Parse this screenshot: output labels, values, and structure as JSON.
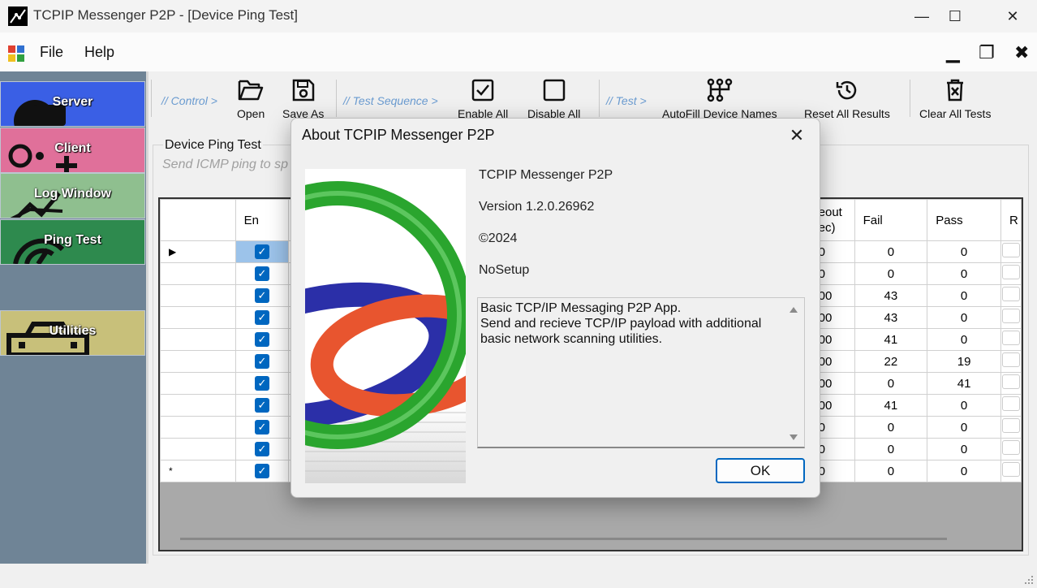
{
  "window": {
    "title": "TCPIP Messenger P2P - [Device Ping Test]",
    "minimize_glyph": "—",
    "maximize_glyph": "☐",
    "close_glyph": "✕"
  },
  "menu": {
    "items": [
      "File",
      "Help"
    ],
    "mdi_minimize": "▁",
    "mdi_restore": "❐",
    "mdi_close": "✖"
  },
  "sidebar": {
    "items": [
      {
        "label": "Server",
        "color": "#3a5fe5",
        "icon": "server-icon"
      },
      {
        "label": "Client",
        "color": "#e0709a",
        "icon": "client-icon"
      },
      {
        "label": "Log Window",
        "color": "#8fbf8f",
        "icon": "chart-icon"
      },
      {
        "label": "Ping Test",
        "color": "#2e8a4e",
        "icon": "ping-icon"
      },
      {
        "label": "Utilities",
        "color": "#c8c07a",
        "icon": "toolbox-icon"
      }
    ]
  },
  "toolbar": {
    "control_label": "// Control >",
    "test_sequence_label": "// Test Sequence >",
    "test_label": "// Test >",
    "buttons": {
      "open": "Open",
      "save_as": "Save As",
      "enable_all": "Enable All",
      "disable_all": "Disable All",
      "autofill": "AutoFill Device Names",
      "reset_all": "Reset All Results",
      "clear_all": "Clear All Tests"
    }
  },
  "group": {
    "title": "Device Ping Test",
    "subtitle": "Send ICMP ping to sp"
  },
  "grid": {
    "columns": {
      "enabled": "En",
      "timeout": "eout\nec)",
      "fail": "Fail",
      "pass": "Pass",
      "result": "R"
    },
    "rows": [
      {
        "marker": "▶",
        "timeout": "0",
        "fail": "0",
        "pass": "0"
      },
      {
        "marker": "",
        "timeout": "0",
        "fail": "0",
        "pass": "0"
      },
      {
        "marker": "",
        "timeout": "00",
        "fail": "43",
        "pass": "0"
      },
      {
        "marker": "",
        "timeout": "00",
        "fail": "43",
        "pass": "0"
      },
      {
        "marker": "",
        "timeout": "00",
        "fail": "41",
        "pass": "0"
      },
      {
        "marker": "",
        "timeout": "00",
        "fail": "22",
        "pass": "19"
      },
      {
        "marker": "",
        "timeout": "00",
        "fail": "0",
        "pass": "41"
      },
      {
        "marker": "",
        "timeout": "00",
        "fail": "41",
        "pass": "0"
      },
      {
        "marker": "",
        "timeout": "0",
        "fail": "0",
        "pass": "0"
      },
      {
        "marker": "",
        "timeout": "0",
        "fail": "0",
        "pass": "0"
      },
      {
        "marker": "*",
        "timeout": "0",
        "fail": "0",
        "pass": "0"
      }
    ],
    "checkbox_glyph": "✓"
  },
  "about_dialog": {
    "title": "About TCPIP Messenger P2P",
    "close_glyph": "✕",
    "product": "TCPIP Messenger P2P",
    "version": "Version 1.2.0.26962",
    "copyright": "©2024",
    "company": "NoSetup",
    "description": "Basic TCP/IP Messaging P2P App.\nSend and recieve TCP/IP payload with additional basic network scanning utilities.",
    "ok_label": "OK"
  }
}
